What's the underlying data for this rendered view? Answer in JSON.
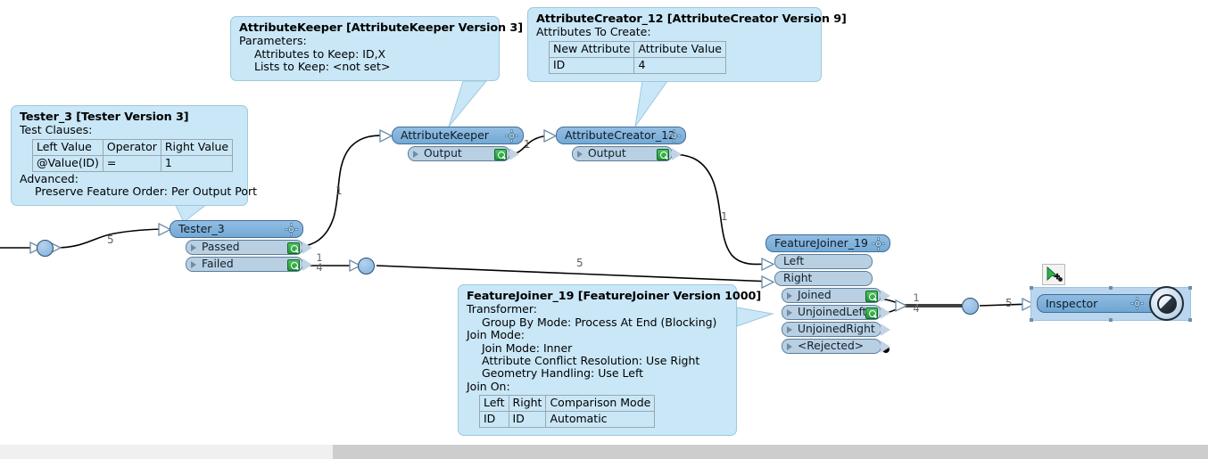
{
  "app": {
    "name": "FME Workbench Canvas"
  },
  "annotations": [
    {
      "id": "ann-tester",
      "title": "Tester_3 [Tester Version 3]",
      "section1": "Test Clauses:",
      "table": {
        "headers": [
          "Left Value",
          "Operator",
          "Right Value"
        ],
        "rows": [
          [
            "@Value(ID)",
            "=",
            "1"
          ]
        ]
      },
      "section2": "Advanced:",
      "detail2": "Preserve Feature Order: Per Output Port"
    },
    {
      "id": "ann-attributekeeper",
      "title": "AttributeKeeper [AttributeKeeper Version 3]",
      "section1": "Parameters:",
      "line1": "Attributes to Keep: ID,X",
      "line2": "Lists to Keep: <not set>"
    },
    {
      "id": "ann-attributecreator",
      "title": "AttributeCreator_12 [AttributeCreator Version 9]",
      "section1": "Attributes To Create:",
      "table": {
        "headers": [
          "New Attribute",
          "Attribute Value"
        ],
        "rows": [
          [
            "ID",
            "4"
          ]
        ]
      }
    },
    {
      "id": "ann-featurejoiner",
      "title": "FeatureJoiner_19 [FeatureJoiner Version 1000]",
      "section1": "Transformer:",
      "line1": "Group By Mode: Process At End (Blocking)",
      "section2": "Join Mode:",
      "line2": "Join Mode: Inner",
      "line3": "Attribute Conflict Resolution: Use Right",
      "line4": "Geometry Handling: Use Left",
      "section3": "Join On:",
      "table": {
        "headers": [
          "Left",
          "Right",
          "Comparison Mode"
        ],
        "rows": [
          [
            "ID",
            "ID",
            "Automatic"
          ]
        ]
      }
    }
  ],
  "nodes": {
    "tester": {
      "title": "Tester_3",
      "ports": [
        {
          "label": "Passed",
          "kind": "output",
          "inspect": true
        },
        {
          "label": "Failed",
          "kind": "output",
          "inspect": true
        }
      ]
    },
    "attributekeeper": {
      "title": "AttributeKeeper",
      "ports": [
        {
          "label": "Output",
          "kind": "output",
          "inspect": true
        }
      ]
    },
    "attributecreator": {
      "title": "AttributeCreator_12",
      "ports": [
        {
          "label": "Output",
          "kind": "output",
          "inspect": true
        }
      ]
    },
    "featurejoiner": {
      "title": "FeatureJoiner_19",
      "ports": [
        {
          "label": "Left",
          "kind": "input",
          "inspect": false
        },
        {
          "label": "Right",
          "kind": "input",
          "inspect": false
        },
        {
          "label": "Joined",
          "kind": "output",
          "inspect": true
        },
        {
          "label": "UnjoinedLeft",
          "kind": "output",
          "inspect": true
        },
        {
          "label": "UnjoinedRight",
          "kind": "output",
          "inspect": false
        },
        {
          "label": "<Rejected>",
          "kind": "output",
          "inspect": false
        }
      ]
    },
    "inspector": {
      "title": "Inspector",
      "selected": true,
      "run_icon": "run-here-cursor-icon"
    }
  },
  "connection_labels": [
    {
      "id": "label-source-count",
      "text": "5"
    },
    {
      "id": "label-passed-count",
      "text": "1"
    },
    {
      "id": "label-keeper-out-count",
      "text": "1"
    },
    {
      "id": "label-creator-out-count",
      "text": "1"
    },
    {
      "id": "label-failed-frac-top",
      "text": "1"
    },
    {
      "id": "label-failed-frac-bottom",
      "text": "4"
    },
    {
      "id": "label-right-count",
      "text": "5"
    },
    {
      "id": "label-joined-frac-top",
      "text": "1"
    },
    {
      "id": "label-joined-frac-bottom",
      "text": "4"
    },
    {
      "id": "label-inspector-count",
      "text": "5"
    }
  ],
  "colors": {
    "annotation_bg": "#c9e7f7",
    "node_header": "#74a9d4",
    "port_bg": "#b9cfe2",
    "inspect_badge": "#23993a",
    "selection_bg": "#b9d6ee",
    "wire": "#000000"
  },
  "scrollbar": {
    "name": "horizontal-scrollbar"
  }
}
